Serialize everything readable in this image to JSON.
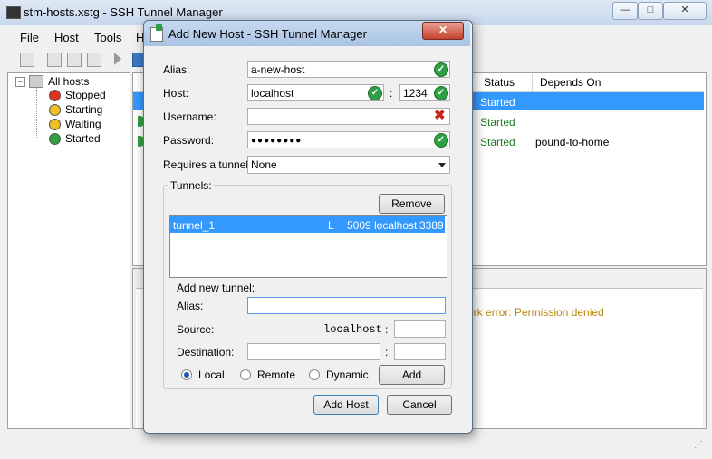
{
  "window": {
    "title": "stm-hosts.xstg - SSH Tunnel Manager",
    "controls": {
      "minimize": "—",
      "maximize": "□",
      "close": "✕"
    }
  },
  "menu": {
    "file": "File",
    "host": "Host",
    "tools": "Tools",
    "help_partial": "H"
  },
  "tree": {
    "root": "All hosts",
    "items": [
      {
        "label": "Stopped",
        "color": "#e03020"
      },
      {
        "label": "Starting",
        "color": "#f0c020"
      },
      {
        "label": "Waiting",
        "color": "#f0c020"
      },
      {
        "label": "Started",
        "color": "#30a040"
      }
    ]
  },
  "grid": {
    "columns": {
      "status": "Status",
      "depends_on": "Depends On"
    },
    "rows": [
      {
        "status": "Started",
        "depends_on": ""
      },
      {
        "status": "Started",
        "depends_on": ""
      },
      {
        "status": "Started",
        "depends_on": "pound-to-home"
      }
    ]
  },
  "log": {
    "line": "ork error: Permission denied"
  },
  "dialog": {
    "title": "Add New Host - SSH Tunnel Manager",
    "close": "✕",
    "alias_label": "Alias:",
    "alias_value": "a-new-host",
    "host_label": "Host:",
    "host_value": "localhost",
    "port_sep": ":",
    "port_value": "1234",
    "username_label": "Username:",
    "username_value": "",
    "password_label": "Password:",
    "password_value": "●●●●●●●●",
    "requires_tunnel_label": "Requires a tunnel:",
    "requires_tunnel_value": "None",
    "tunnels_group_label": "Tunnels:",
    "remove_button": "Remove",
    "tunnel_row": {
      "name": "tunnel_1",
      "type": "L",
      "port": "5009",
      "host": "localhost",
      "dest_port": "3389"
    },
    "add_new_tunnel_label": "Add new tunnel:",
    "new_alias_label": "Alias:",
    "new_alias_value": "",
    "source_label": "Source:",
    "source_host": "localhost",
    "source_sep": ":",
    "source_port": "",
    "destination_label": "Destination:",
    "destination_host": "",
    "destination_sep": ":",
    "destination_port": "",
    "radio_local": "Local",
    "radio_remote": "Remote",
    "radio_dynamic": "Dynamic",
    "add_button": "Add",
    "add_host_button": "Add Host",
    "cancel_button": "Cancel"
  }
}
